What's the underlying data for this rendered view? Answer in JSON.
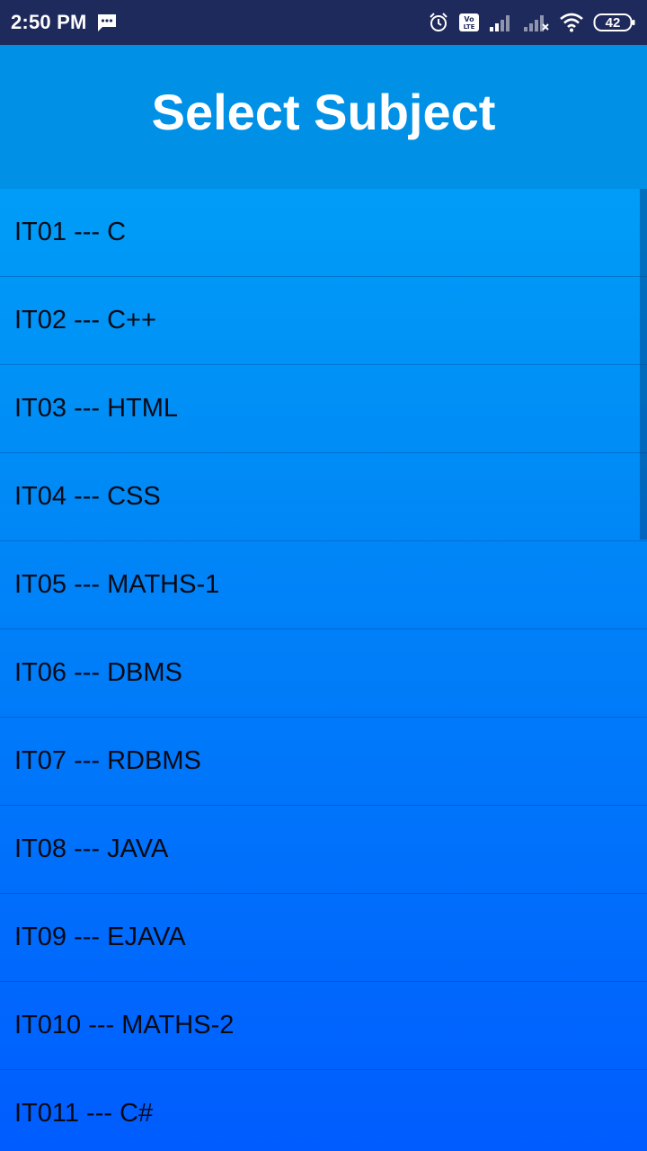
{
  "status_bar": {
    "time": "2:50 PM",
    "battery": "42",
    "icons": [
      "message-icon",
      "alarm-icon",
      "volte-icon",
      "signal-icon",
      "signal-no-service-icon",
      "wifi-icon",
      "battery-icon"
    ]
  },
  "app_bar": {
    "title": "Select Subject"
  },
  "subjects": [
    {
      "label": "IT01 --- C"
    },
    {
      "label": "IT02 --- C++"
    },
    {
      "label": "IT03 --- HTML"
    },
    {
      "label": "IT04 --- CSS"
    },
    {
      "label": "IT05 --- MATHS-1"
    },
    {
      "label": "IT06 --- DBMS"
    },
    {
      "label": "IT07 --- RDBMS"
    },
    {
      "label": "IT08 --- JAVA"
    },
    {
      "label": "IT09 --- EJAVA"
    },
    {
      "label": "IT010 --- MATHS-2"
    },
    {
      "label": "IT011 --- C#"
    }
  ],
  "colors": {
    "status_bar": "#1f2a5c",
    "app_bar": "#0090e6",
    "list_top": "#00a8f8",
    "list_bottom": "#005cff"
  }
}
